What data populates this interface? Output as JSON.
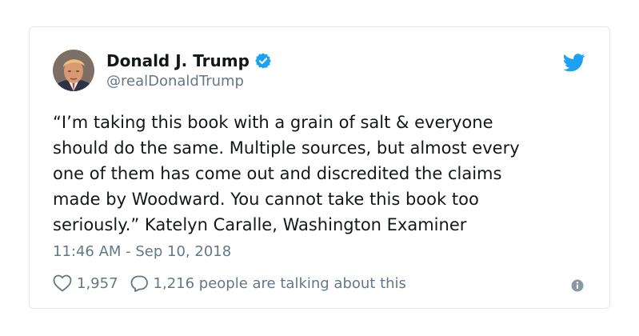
{
  "tweet": {
    "author_name": "Donald J. Trump",
    "handle": "@realDonaldTrump",
    "text": "“I’m taking this book with a grain of salt & everyone\nshould do the same. Multiple sources, but almost every\none of them has come out and discredited the claims\nmade by Woodward. You cannot take this book too\nseriously.” Katelyn Caralle, Washington Examiner",
    "timestamp": "11:46 AM - Sep 10, 2018",
    "likes": "1,957",
    "conversation": "1,216 people are talking about this"
  },
  "icons": {
    "verified": "verified-badge-icon",
    "brand": "twitter-bird-icon",
    "like": "heart-icon",
    "reply": "speech-bubble-icon",
    "info": "info-icon"
  },
  "colors": {
    "accent": "#1da1f2",
    "text": "#14171a",
    "muted": "#657786",
    "border": "#e1e8ed"
  }
}
